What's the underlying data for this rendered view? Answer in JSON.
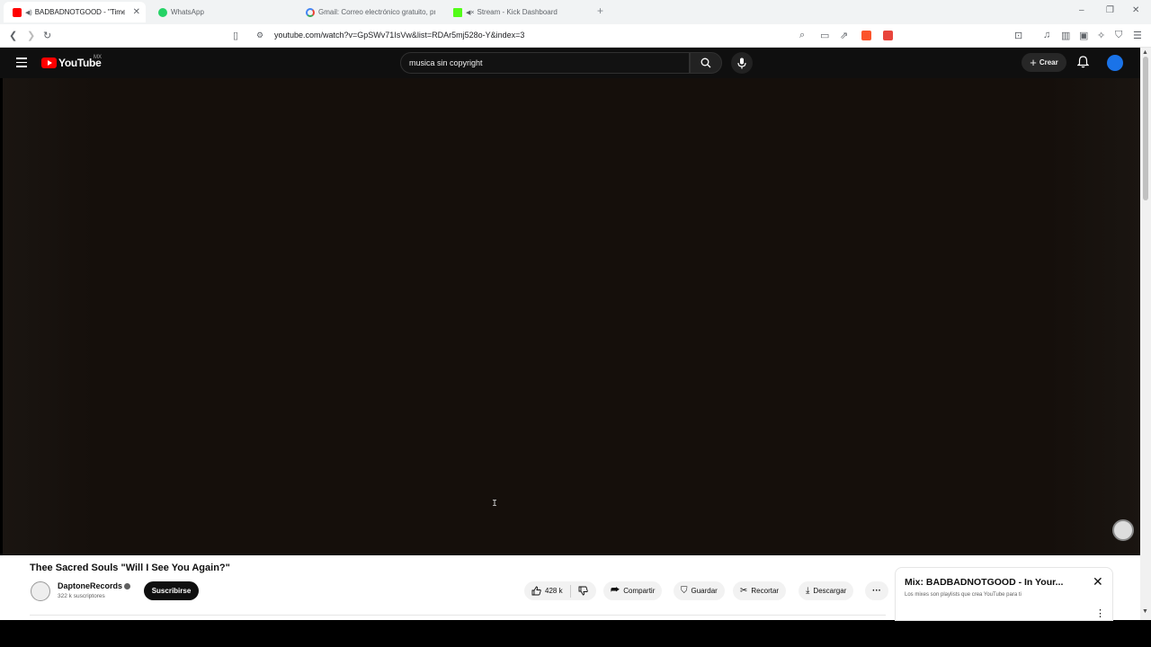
{
  "browser": {
    "tabs": [
      {
        "label": "BADBADNOTGOOD - \"Time M",
        "icon": "youtube-icon",
        "active": true
      },
      {
        "label": "WhatsApp",
        "icon": "whatsapp-icon",
        "active": false
      },
      {
        "label": "Gmail: Correo electrónico gratuito, pr",
        "icon": "google-icon",
        "active": false
      },
      {
        "label": "Stream - Kick Dashboard",
        "icon": "kick-icon",
        "active": false
      }
    ],
    "url": "youtube.com/watch?v=GpSWv71IsVw&list=RDAr5mj528o-Y&index=3"
  },
  "youtube": {
    "logo_text": "YouTube",
    "region": "MX",
    "search_value": "musica sin copyright",
    "create_label": "Crear"
  },
  "video": {
    "title": "Thee Sacred Souls \"Will I See You Again?\"",
    "channel": "DaptoneRecords",
    "subscribers": "322 k suscriptores",
    "subscribe_label": "Suscribirse",
    "likes": "428 k",
    "share_label": "Compartir",
    "save_label": "Guardar",
    "clip_label": "Recortar",
    "download_label": "Descargar"
  },
  "mix": {
    "title": "Mix: BADBADNOTGOOD - In Your...",
    "subtitle": "Los mixes son playlists que crea YouTube para ti"
  },
  "colors": {
    "youtube_red": "#ff0000",
    "header_bg": "#0f0f0f",
    "player_bg": "#150f0b"
  }
}
